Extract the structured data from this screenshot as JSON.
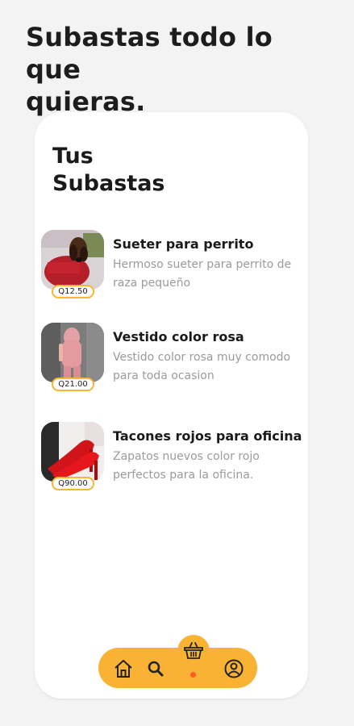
{
  "hero": {
    "line1": "Subastas todo lo que",
    "line2": "quieras."
  },
  "screen": {
    "title_line1": "Tus",
    "title_line2": "Subastas"
  },
  "items": [
    {
      "name": "Sueter para perrito",
      "description": "Hermoso sueter para perrito de raza pequeño",
      "price": "Q12.50"
    },
    {
      "name": "Vestido color rosa",
      "description": "Vestido color rosa muy comodo para toda ocasion",
      "price": "Q21.00"
    },
    {
      "name": "Tacones rojos para oficina",
      "description": "Zapatos nuevos color rojo perfectos para la oficina.",
      "price": "Q90.00"
    }
  ],
  "nav": {
    "items": [
      "home-icon",
      "search-icon",
      "basket-icon",
      "profile-icon"
    ],
    "accent": "#f9b233",
    "active_dot": "#ff5a1f"
  }
}
